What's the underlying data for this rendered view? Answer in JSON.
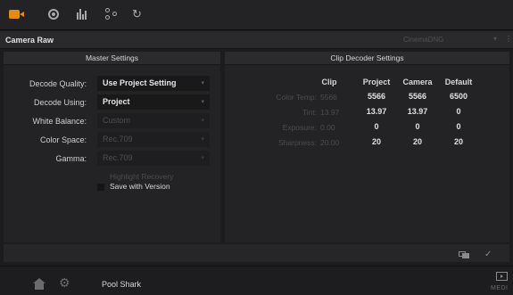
{
  "toolbar": {
    "icons": [
      "camera-raw-icon",
      "color-wheel-icon",
      "histogram-icon",
      "nodes-icon",
      "sync-icon"
    ],
    "accent_color": "#e58a17"
  },
  "header": {
    "title": "Camera Raw",
    "format": "CinemaDNG"
  },
  "master": {
    "heading": "Master Settings",
    "rows": [
      {
        "label": "Decode Quality:",
        "value": "Use Project Setting"
      },
      {
        "label": "Decode Using:",
        "value": "Project"
      },
      {
        "label": "White Balance:",
        "value": "Custom"
      },
      {
        "label": "Color Space:",
        "value": "Rec.709"
      },
      {
        "label": "Gamma:",
        "value": "Rec.709"
      }
    ],
    "highlight_recovery": "Highlight Recovery",
    "save_with_version": "Save with Version"
  },
  "clip_decoder": {
    "heading": "Clip Decoder Settings",
    "columns": [
      "Clip",
      "Project",
      "Camera",
      "Default"
    ],
    "rows": [
      {
        "label": "Color Temp:",
        "clip": "5566",
        "project": "5566",
        "camera": "5566",
        "default": "6500"
      },
      {
        "label": "Tint:",
        "clip": "13.97",
        "project": "13.97",
        "camera": "13.97",
        "default": "0"
      },
      {
        "label": "Exposure:",
        "clip": "0.00",
        "project": "0",
        "camera": "0",
        "default": "0"
      },
      {
        "label": "Sharpness:",
        "clip": "20.00",
        "project": "20",
        "camera": "20",
        "default": "20"
      }
    ]
  },
  "footer": {
    "project_name": "Pool Shark",
    "media_label": "MEDI"
  }
}
